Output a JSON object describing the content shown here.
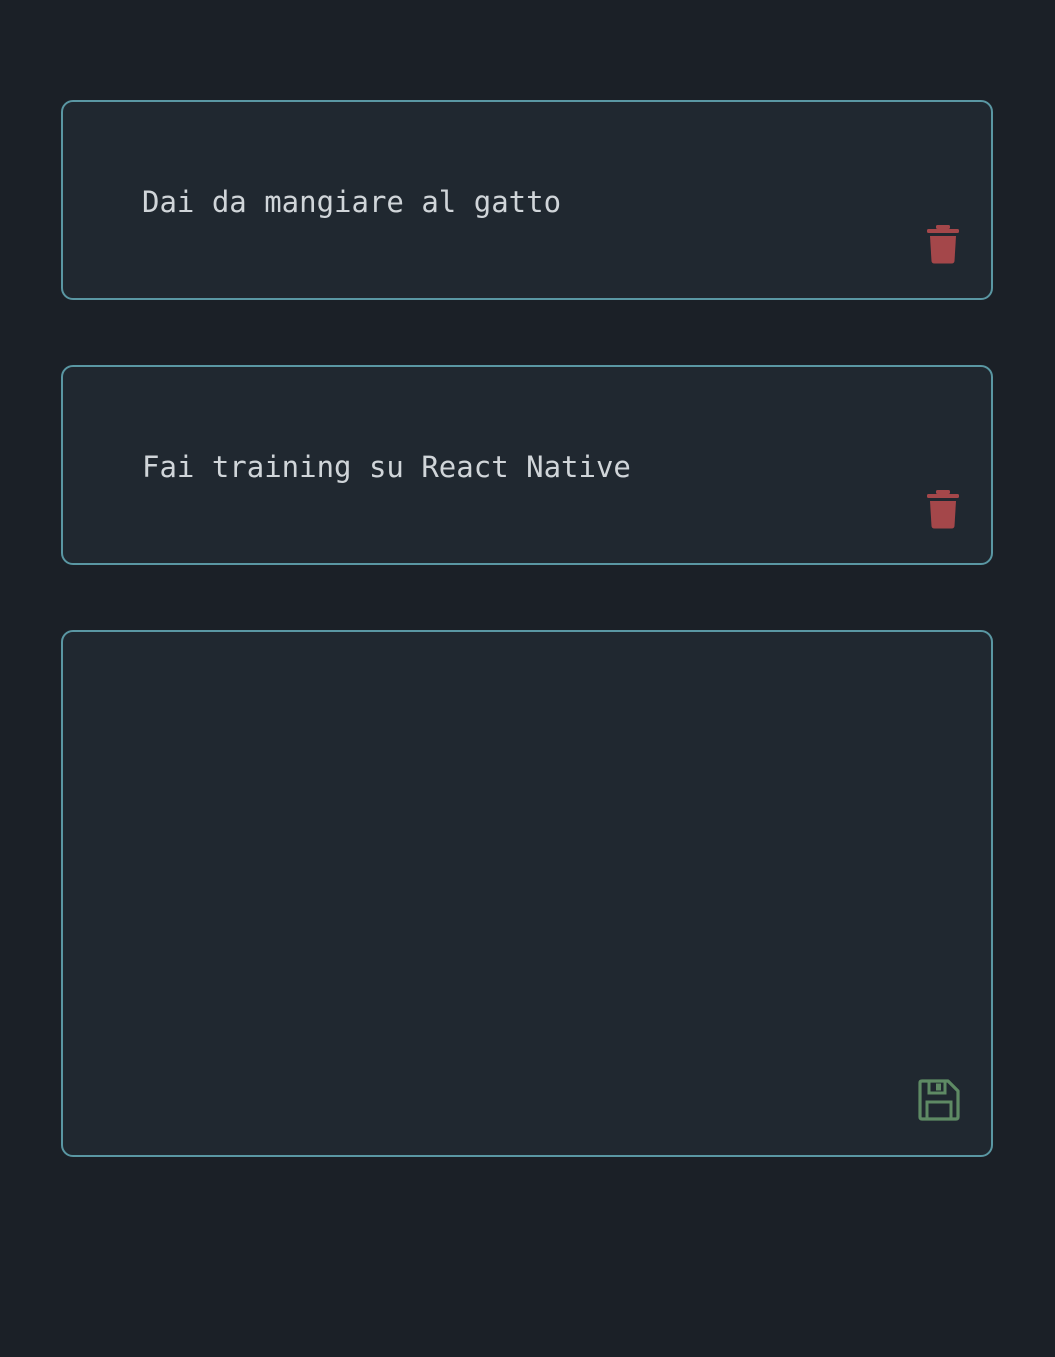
{
  "colors": {
    "background": "#1b2027",
    "card_background": "#202830",
    "card_border": "#5a97a3",
    "text": "#d0d5d9",
    "delete_icon": "#a4474a",
    "save_icon": "#5e8a64"
  },
  "todos": [
    {
      "text": "Dai da mangiare al gatto",
      "action_icon": "trash-icon"
    },
    {
      "text": "Fai training su React Native",
      "action_icon": "trash-icon"
    }
  ],
  "editor": {
    "value": "",
    "placeholder": "",
    "action_icon": "floppy-disk-save-icon"
  }
}
